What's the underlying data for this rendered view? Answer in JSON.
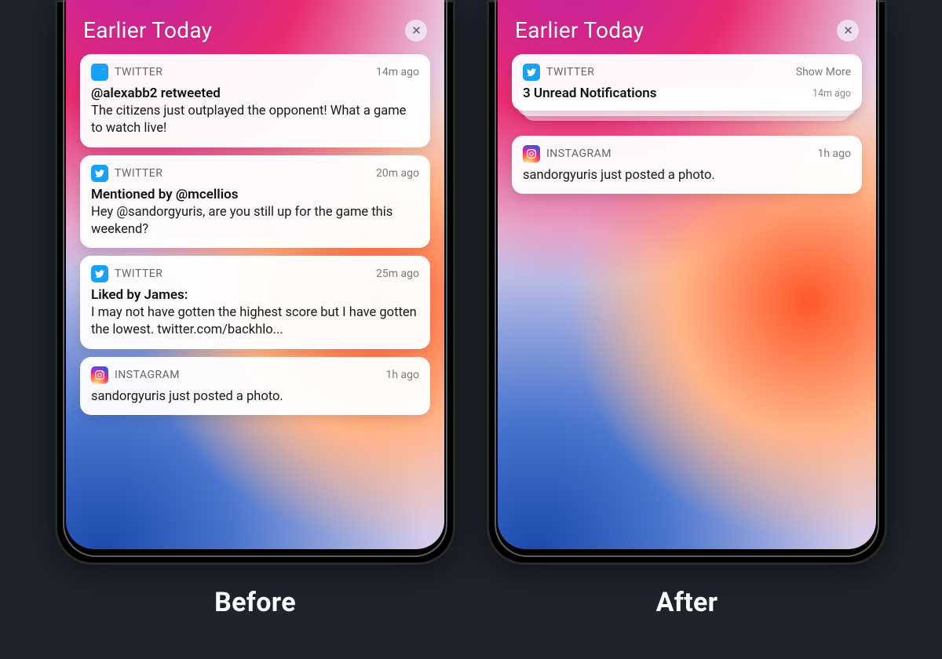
{
  "captions": {
    "before": "Before",
    "after": "After"
  },
  "section_title": "Earlier Today",
  "apps": {
    "twitter": "TWITTER",
    "instagram": "INSTAGRAM"
  },
  "showMoreLabel": "Show More",
  "before": [
    {
      "app": "twitter",
      "time": "14m ago",
      "title": "@alexabb2 retweeted",
      "body": "The citizens just outplayed the opponent! What a game to watch live!"
    },
    {
      "app": "twitter",
      "time": "20m ago",
      "title": "Mentioned by @mcellios",
      "body": "Hey @sandorgyuris, are you still up for the game this weekend?"
    },
    {
      "app": "twitter",
      "time": "25m ago",
      "title": "Liked by James:",
      "body": "I may not have gotten the highest score but I have gotten the lowest. twitter.com/backhlo..."
    },
    {
      "app": "instagram",
      "time": "1h ago",
      "title": "",
      "body": "sandorgyuris just posted a photo."
    }
  ],
  "after": {
    "grouped": {
      "app": "twitter",
      "summary": "3 Unread Notifications",
      "time": "14m ago"
    },
    "single": {
      "app": "instagram",
      "body": "sandorgyuris just posted a photo.",
      "time": "1h ago"
    }
  }
}
